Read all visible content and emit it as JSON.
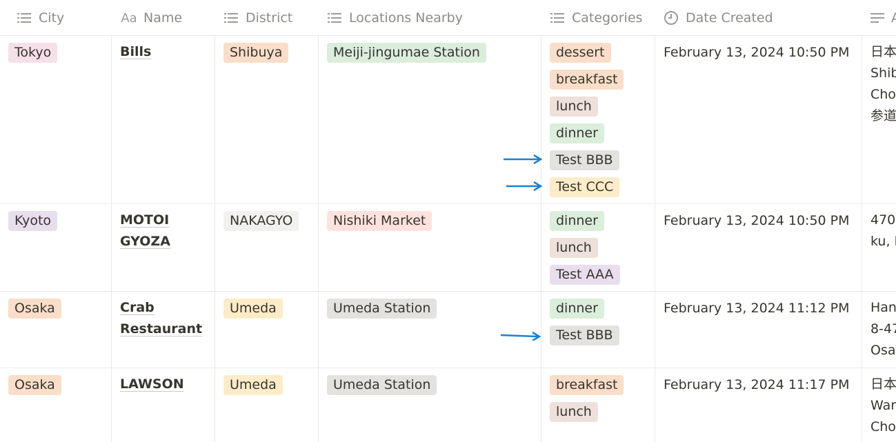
{
  "columns": [
    {
      "label": "City",
      "icon": "list-icon"
    },
    {
      "label": "Name",
      "icon": "title-icon",
      "icon_text": "Aa"
    },
    {
      "label": "District",
      "icon": "list-icon"
    },
    {
      "label": "Locations Nearby",
      "icon": "list-icon"
    },
    {
      "label": "Categories",
      "icon": "list-icon"
    },
    {
      "label": "Date Created",
      "icon": "clock-icon"
    },
    {
      "label": "A",
      "icon": "text-icon"
    }
  ],
  "rows": [
    {
      "city": {
        "label": "Tokyo",
        "color": "#f5e0e9"
      },
      "name_lines": [
        "Bills"
      ],
      "district": {
        "label": "Shibuya",
        "color": "#fadec9"
      },
      "location": {
        "label": "Meiji-jingumae Station",
        "color": "#dbeddb"
      },
      "categories": [
        {
          "label": "dessert",
          "color": "#fadec9"
        },
        {
          "label": "breakfast",
          "color": "#fadec9"
        },
        {
          "label": "lunch",
          "color": "#eee0da"
        },
        {
          "label": "dinner",
          "color": "#dbeddb"
        },
        {
          "label": "Test BBB",
          "color": "#e3e2e0",
          "arrow": true
        },
        {
          "label": "Test CCC",
          "color": "#fdecc8",
          "arrow": true
        }
      ],
      "date": "February 13, 2024 10:50 PM",
      "address_lines": [
        "日本、",
        "Shib",
        "Cho",
        "参道"
      ]
    },
    {
      "city": {
        "label": "Kyoto",
        "color": "#e8deee"
      },
      "name_lines": [
        "MOTOI",
        "GYOZA"
      ],
      "district": {
        "label": "NAKAGYO",
        "color": "#f1f1ef"
      },
      "location": {
        "label": "Nishiki Market",
        "color": "#ffe2dd"
      },
      "categories": [
        {
          "label": "dinner",
          "color": "#dbeddb"
        },
        {
          "label": "lunch",
          "color": "#eee0da"
        },
        {
          "label": "Test AAA",
          "color": "#e8deee"
        }
      ],
      "date": "February 13, 2024 10:50 PM",
      "address_lines": [
        "470-",
        "ku, K"
      ]
    },
    {
      "city": {
        "label": "Osaka",
        "color": "#fadec9"
      },
      "name_lines": [
        "Crab",
        "Restaurant"
      ],
      "district": {
        "label": "Umeda",
        "color": "#fdecc8"
      },
      "location": {
        "label": "Umeda Station",
        "color": "#e3e2e0"
      },
      "categories": [
        {
          "label": "dinner",
          "color": "#dbeddb"
        },
        {
          "label": "Test BBB",
          "color": "#e3e2e0",
          "arrow": true
        }
      ],
      "date": "February 13, 2024 11:12 PM",
      "address_lines": [
        "Han",
        "8-47",
        "Osak"
      ]
    },
    {
      "city": {
        "label": "Osaka",
        "color": "#fadec9"
      },
      "name_lines": [
        "LAWSON"
      ],
      "district": {
        "label": "Umeda",
        "color": "#fdecc8"
      },
      "location": {
        "label": "Umeda Station",
        "color": "#e3e2e0"
      },
      "categories": [
        {
          "label": "breakfast",
          "color": "#fadec9"
        },
        {
          "label": "lunch",
          "color": "#eee0da"
        }
      ],
      "date": "February 13, 2024 11:17 PM",
      "address_lines": [
        "日本、",
        "War",
        "Cho"
      ]
    }
  ],
  "theme": {
    "text": "#37352f",
    "header_text": "#8c8b87",
    "border": "#e9e9e7",
    "arrow": "#1a7fd4"
  }
}
